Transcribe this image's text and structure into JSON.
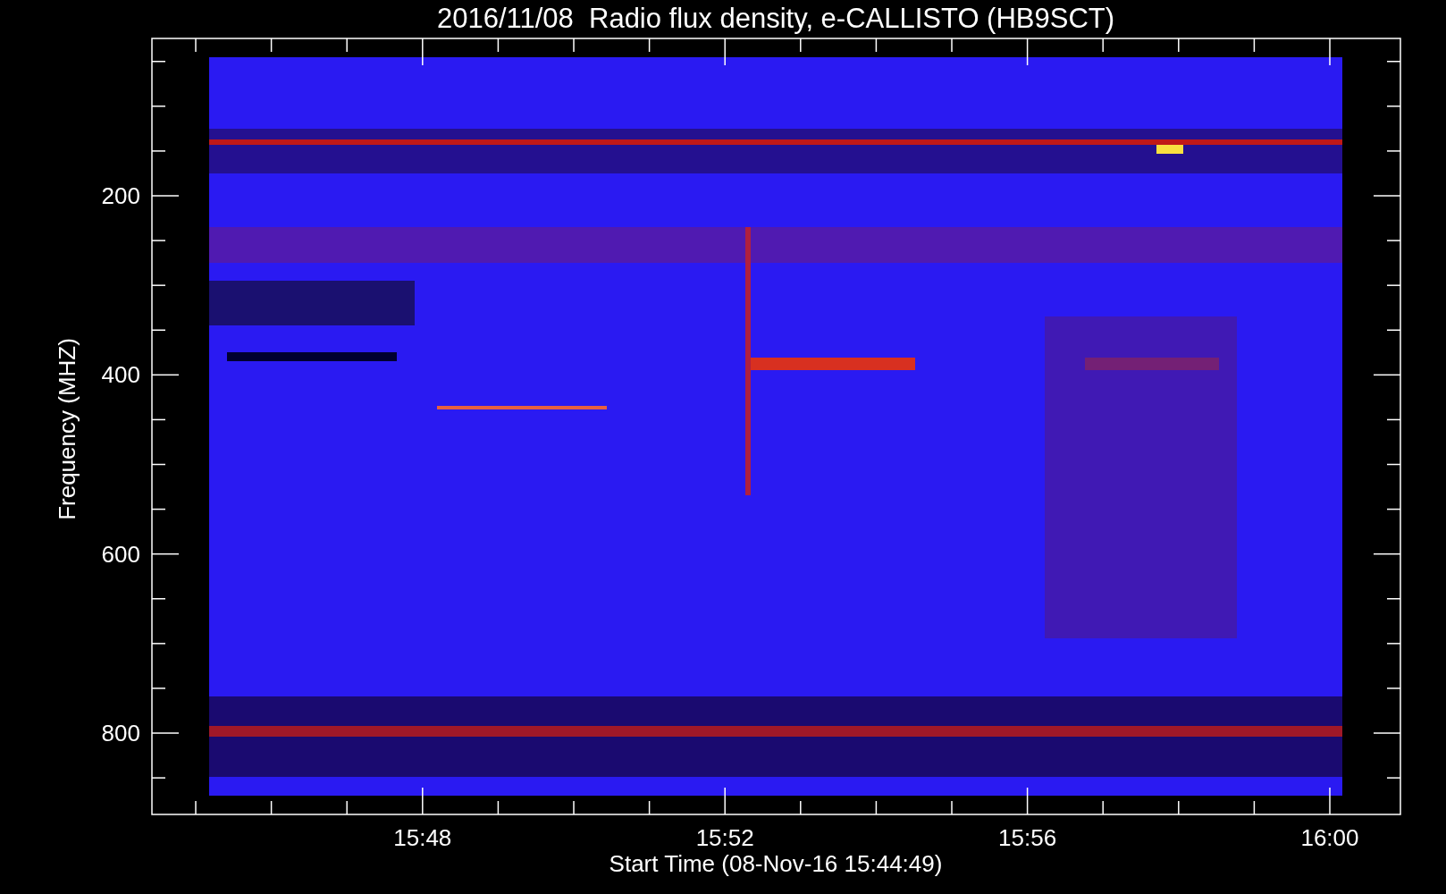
{
  "title": "2016/11/08  Radio flux density, e-CALLISTO (HB9SCT)",
  "y_axis": {
    "label": "Frequency (MHZ)",
    "ticks": [
      "200",
      "400",
      "600",
      "800"
    ]
  },
  "x_axis": {
    "label": "Start Time (08-Nov-16 15:44:49)",
    "ticks": [
      "15:48",
      "15:52",
      "15:56",
      "16:00"
    ]
  }
}
